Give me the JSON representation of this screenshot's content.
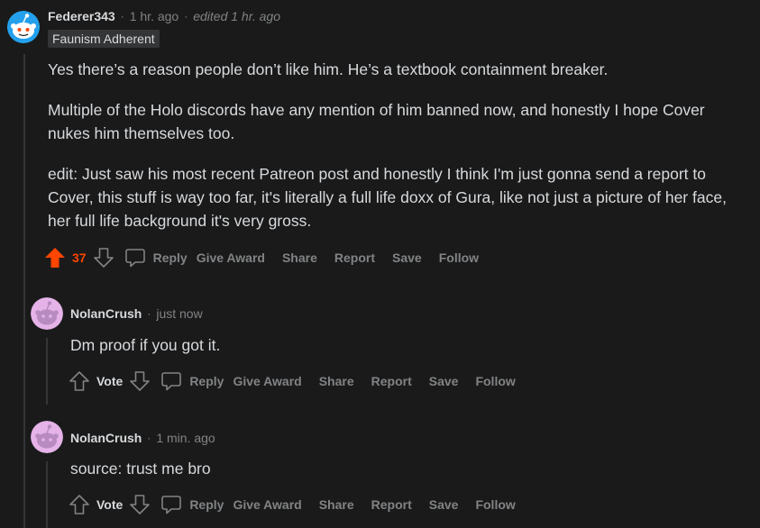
{
  "colors": {
    "background": "#1a1a1b",
    "text": "#d7dadc",
    "muted": "#818384",
    "upvote": "#ff4500",
    "thread": "#343536"
  },
  "comments": [
    {
      "username": "Federer343",
      "time": "1 hr. ago",
      "edited": "edited 1 hr. ago",
      "flair": "Faunism Adherent",
      "avatar_icon": "snoo-blue-avatar",
      "paragraphs": [
        "Yes there’s a reason people don’t like him. He’s a textbook containment breaker.",
        "Multiple of the Holo discords have any mention of him banned now, and honestly I hope Cover nukes him themselves too.",
        "edit: Just saw his most recent Patreon post and honestly I think I'm just gonna send a report to Cover, this stuff is way too far, it's literally a full life doxx of Gura, like not just a picture of her face, her full life background it's very gross."
      ],
      "vote": "37",
      "upvoted": true
    },
    {
      "username": "NolanCrush",
      "time": "just now",
      "avatar_icon": "snoo-purple-avatar",
      "paragraphs": [
        "Dm proof if you got it."
      ],
      "vote": "Vote",
      "upvoted": false
    },
    {
      "username": "NolanCrush",
      "time": "1 min. ago",
      "avatar_icon": "snoo-purple-avatar",
      "paragraphs": [
        "source: trust me bro"
      ],
      "vote": "Vote",
      "upvoted": false
    }
  ],
  "actions": {
    "reply": "Reply",
    "give_award": "Give Award",
    "share": "Share",
    "report": "Report",
    "save": "Save",
    "follow": "Follow"
  }
}
